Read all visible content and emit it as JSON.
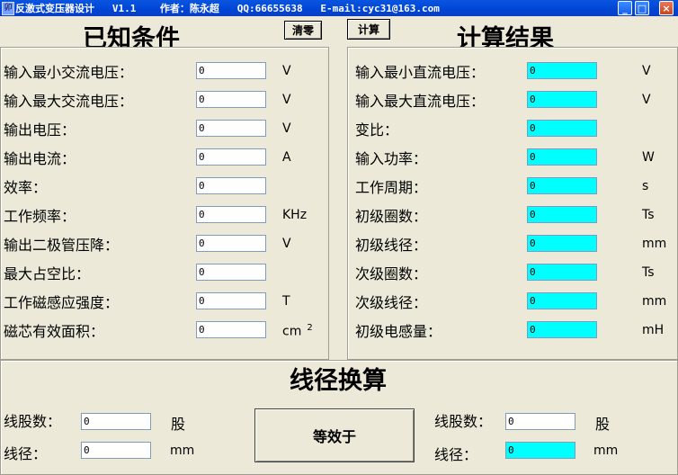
{
  "window": {
    "title": "反激式变压器设计   V1.1    作者：陈永超   QQ:66655638   E-mail:cyc31@163.com",
    "icon_glyph": "卯",
    "minimize": "_",
    "maximize": "□",
    "close": "×"
  },
  "known": {
    "heading": "已知条件",
    "clear_label": "清零",
    "rows": [
      {
        "label": "输入最小交流电压：",
        "value": "0",
        "unit": "V"
      },
      {
        "label": "输入最大交流电压：",
        "value": "0",
        "unit": "V"
      },
      {
        "label": "输出电压：",
        "value": "0",
        "unit": "V"
      },
      {
        "label": "输出电流：",
        "value": "0",
        "unit": "A"
      },
      {
        "label": "效率：",
        "value": "0",
        "unit": ""
      },
      {
        "label": "工作频率：",
        "value": "0",
        "unit": "KHz"
      },
      {
        "label": "输出二极管压降：",
        "value": "0",
        "unit": "V"
      },
      {
        "label": "最大占空比：",
        "value": "0",
        "unit": ""
      },
      {
        "label": "工作磁感应强度：",
        "value": "0",
        "unit": "T"
      },
      {
        "label": "磁芯有效面积：",
        "value": "0",
        "unit": "cm",
        "unit_sup": "2"
      }
    ]
  },
  "results": {
    "heading": "计算结果",
    "calc_label": "计算",
    "rows": [
      {
        "label": "输入最小直流电压：",
        "value": "0",
        "unit": "V"
      },
      {
        "label": "输入最大直流电压：",
        "value": "0",
        "unit": "V"
      },
      {
        "label": "变比：",
        "value": "0",
        "unit": ""
      },
      {
        "label": "输入功率：",
        "value": "0",
        "unit": "W"
      },
      {
        "label": "工作周期：",
        "value": "0",
        "unit": "s"
      },
      {
        "label": "初级圈数：",
        "value": "0",
        "unit": "Ts"
      },
      {
        "label": "初级线径：",
        "value": "0",
        "unit": "mm"
      },
      {
        "label": "次级圈数：",
        "value": "0",
        "unit": "Ts"
      },
      {
        "label": "次级线径：",
        "value": "0",
        "unit": "mm"
      },
      {
        "label": "初级电感量：",
        "value": "0",
        "unit": "mH"
      }
    ]
  },
  "wire": {
    "heading": "线径换算",
    "equivalent_label": "等效于",
    "left": {
      "strands_label": "线股数：",
      "strands_value": "0",
      "strands_unit": "股",
      "diameter_label": "线径：",
      "diameter_value": "0",
      "diameter_unit": "mm"
    },
    "right": {
      "strands_label": "线股数：",
      "strands_value": "0",
      "strands_unit": "股",
      "diameter_label": "线径：",
      "diameter_value": "0",
      "diameter_unit": "mm"
    }
  },
  "colors": {
    "output_field": "#00ffff",
    "title_bar": "#0a55e0"
  }
}
